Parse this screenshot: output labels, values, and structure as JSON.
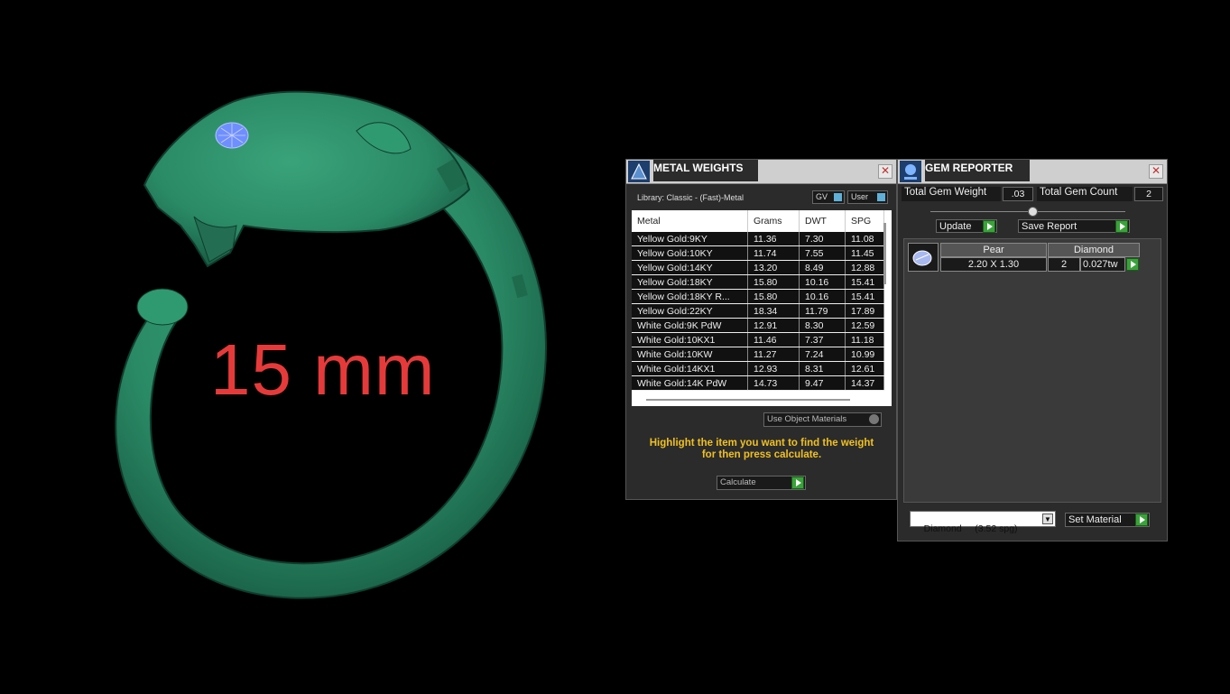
{
  "viewport": {
    "dimension_label": "15 mm"
  },
  "metal_weights": {
    "title": "METAL WEIGHTS",
    "close_label": "✕",
    "library_label": "Library: Classic - (Fast)-Metal",
    "gv_label": "GV",
    "user_label": "User",
    "columns": [
      "Metal",
      "Grams",
      "DWT",
      "SPG"
    ],
    "rows": [
      [
        "Yellow Gold:9KY",
        "11.36",
        "7.30",
        "11.08"
      ],
      [
        "Yellow Gold:10KY",
        "11.74",
        "7.55",
        "11.45"
      ],
      [
        "Yellow Gold:14KY",
        "13.20",
        "8.49",
        "12.88"
      ],
      [
        "Yellow Gold:18KY",
        "15.80",
        "10.16",
        "15.41"
      ],
      [
        "Yellow Gold:18KY R...",
        "15.80",
        "10.16",
        "15.41"
      ],
      [
        "Yellow Gold:22KY",
        "18.34",
        "11.79",
        "17.89"
      ],
      [
        "White Gold:9K PdW",
        "12.91",
        "8.30",
        "12.59"
      ],
      [
        "White Gold:10KX1",
        "11.46",
        "7.37",
        "11.18"
      ],
      [
        "White Gold:10KW",
        "11.27",
        "7.24",
        "10.99"
      ],
      [
        "White Gold:14KX1",
        "12.93",
        "8.31",
        "12.61"
      ],
      [
        "White Gold:14K PdW",
        "14.73",
        "9.47",
        "14.37"
      ]
    ],
    "use_object_materials": "Use Object Materials",
    "instruction": "Highlight the item you want to find the weight for then press calculate.",
    "calculate_label": "Calculate"
  },
  "gem_reporter": {
    "title": "GEM REPORTER",
    "close_label": "✕",
    "total_weight_label": "Total Gem Weight",
    "total_weight_value": ".03",
    "total_count_label": "Total Gem Count",
    "total_count_value": "2",
    "update_label": "Update",
    "save_report_label": "Save Report",
    "gem": {
      "shape": "Pear",
      "material": "Diamond",
      "size": "2.20 X 1.30",
      "count": "2",
      "weight": "0.027tw"
    },
    "material_select": "Diamond     (3.52 spg)",
    "set_material_label": "Set Material"
  },
  "colors": {
    "ring": "#2a8a66",
    "gem": "#6f8fff",
    "label": "#e63a3a",
    "instruction": "#f0c020",
    "accent_green": "#3aa33a"
  }
}
